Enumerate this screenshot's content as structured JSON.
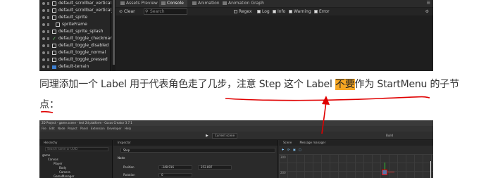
{
  "top_screenshot": {
    "hierarchy_items": [
      {
        "label": "default_scrollbar_vertical",
        "icon": "image-node-icon"
      },
      {
        "label": "default_scrollbar_vertical_l",
        "icon": "image-node-icon"
      },
      {
        "label": "default_sprite",
        "icon": "image-node-icon"
      },
      {
        "label": "spriteFrame",
        "icon": "image-node-icon"
      },
      {
        "label": "default_sprite_splash",
        "icon": "image-node-icon"
      },
      {
        "label": "default_toggle_checkmark",
        "icon": "checkmark-icon"
      },
      {
        "label": "default_toggle_disabled",
        "icon": "image-node-icon"
      },
      {
        "label": "default_toggle_normal",
        "icon": "image-node-icon"
      },
      {
        "label": "default_toggle_pressed",
        "icon": "image-node-icon"
      },
      {
        "label": "default-terrain",
        "icon": "folder-icon"
      }
    ],
    "tabs": [
      "Assets Preview",
      "Console",
      "Animation",
      "Animation Graph"
    ],
    "console_toolbar": {
      "clear": "Clear",
      "search_placeholder": "Search",
      "filters": [
        {
          "label": "Regex",
          "checked": false
        },
        {
          "label": "Log",
          "checked": true
        },
        {
          "label": "Info",
          "checked": true
        },
        {
          "label": "Warning",
          "checked": true
        },
        {
          "label": "Error",
          "checked": true
        }
      ]
    }
  },
  "paragraph": {
    "before": "同理添加一个 Label 用于代表角色走了几步，注意 Step 这个 Label ",
    "highlight": "不要",
    "after_line1": "作为 StartMenu 的子节",
    "line2": "点："
  },
  "bottom_screenshot": {
    "title": "2D Project - game.scene - test 2d platform - Cocos Creator 3.7.1",
    "menu": [
      "File",
      "Edit",
      "Node",
      "Project",
      "Panel",
      "Extension",
      "Developer",
      "Help"
    ],
    "scene_dropdown": "Current scene",
    "build_label": "Build",
    "hierarchy_title": "Hierarchy",
    "hierarchy_search": "Search name or UUID",
    "hierarchy_nodes": [
      {
        "label": "game",
        "indent": 0
      },
      {
        "label": "Canvas",
        "indent": 1
      },
      {
        "label": "Player",
        "indent": 2
      },
      {
        "label": "Body",
        "indent": 3
      },
      {
        "label": "Camera",
        "indent": 3
      },
      {
        "label": "GameManager",
        "indent": 2
      }
    ],
    "inspector_title": "Inspector",
    "inspector_node_name": "Step",
    "node_section": "Node",
    "position_label": "Position",
    "position_x": "-348.916",
    "position_y": "252.897",
    "rotation_label": "Rotation",
    "rotation_value": "0",
    "scene_tab": "Scene",
    "message_tab": "Message manager",
    "scene_ruler": [
      "300",
      "200"
    ]
  },
  "annotation_color": "#e00000"
}
